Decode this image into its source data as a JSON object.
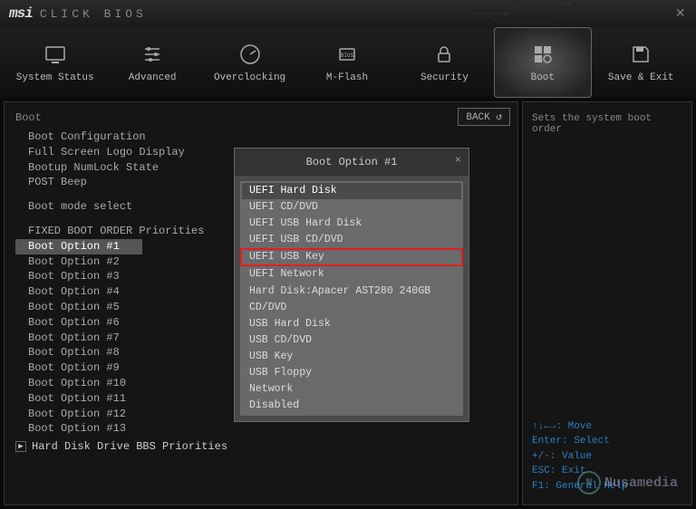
{
  "header": {
    "brand": "msi",
    "title": "CLICK BIOS"
  },
  "nav": [
    {
      "label": "System Status",
      "icon": "monitor"
    },
    {
      "label": "Advanced",
      "icon": "sliders"
    },
    {
      "label": "Overclocking",
      "icon": "gauge"
    },
    {
      "label": "M-Flash",
      "icon": "chip"
    },
    {
      "label": "Security",
      "icon": "lock"
    },
    {
      "label": "Boot",
      "icon": "grid",
      "active": true
    },
    {
      "label": "Save & Exit",
      "icon": "save"
    }
  ],
  "back_label": "BACK ↺",
  "page_title": "Boot",
  "config": {
    "items": [
      "Boot Configuration",
      "Full Screen Logo Display",
      "Bootup NumLock State",
      "POST Beep"
    ],
    "boot_mode": "Boot mode select",
    "fixed_label": "FIXED BOOT ORDER Priorities",
    "boot_options": [
      "Boot Option #1",
      "Boot Option #2",
      "Boot Option #3",
      "Boot Option #4",
      "Boot Option #5",
      "Boot Option #6",
      "Boot Option #7",
      "Boot Option #8",
      "Boot Option #9",
      "Boot Option #10",
      "Boot Option #11",
      "Boot Option #12",
      "Boot Option #13"
    ],
    "bbs": "Hard Disk Drive BBS Priorities"
  },
  "dialog": {
    "title": "Boot Option #1",
    "options": [
      "UEFI Hard Disk",
      "UEFI CD/DVD",
      "UEFI USB Hard Disk",
      "UEFI USB CD/DVD",
      "UEFI USB Key",
      "UEFI Network",
      "Hard Disk:Apacer AST280 240GB",
      "CD/DVD",
      "USB Hard Disk",
      "USB CD/DVD",
      "USB Key",
      "USB Floppy",
      "Network",
      "Disabled"
    ],
    "selected_dark": 0,
    "selected_red": 4
  },
  "sidebar": {
    "desc": "Sets the system boot order",
    "help": [
      "↑↓←→: Move",
      "Enter: Select",
      "+/-: Value",
      "ESC: Exit",
      "F1: General Help"
    ]
  },
  "watermark": {
    "symbol": "N",
    "text": "Nusamedia"
  }
}
